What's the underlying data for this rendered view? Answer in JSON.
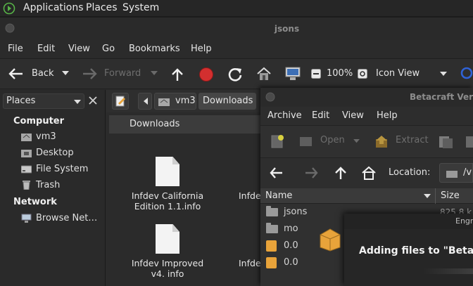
{
  "panel": {
    "applications": "Applications",
    "places": "Places",
    "system": "System"
  },
  "file_manager": {
    "title": "jsons",
    "menu": [
      "File",
      "Edit",
      "View",
      "Go",
      "Bookmarks",
      "Help"
    ],
    "toolbar": {
      "back": "Back",
      "forward": "Forward",
      "zoom": "100%",
      "view_mode": "Icon View"
    },
    "sidebar": {
      "selector": "Places",
      "computer_heading": "Computer",
      "computer_items": [
        "vm3",
        "Desktop",
        "File System",
        "Trash"
      ],
      "network_heading": "Network",
      "network_items": [
        "Browse Net…"
      ]
    },
    "pathbar": {
      "crumbs": [
        "vm3",
        "Downloads"
      ]
    },
    "location_header": "Downloads",
    "files": [
      {
        "name": "Infdev California Edition 1.1.info"
      },
      {
        "name": "Infde"
      },
      {
        "name": "Infdev Improved v4. info"
      },
      {
        "name": "Infde"
      }
    ]
  },
  "archive_manager": {
    "title": "Betacraft Versi",
    "menu": [
      "Archive",
      "Edit",
      "View",
      "Help"
    ],
    "toolbar": {
      "open": "Open",
      "extract": "Extract"
    },
    "location_label": "Location:",
    "location_value": "/v",
    "columns": {
      "name": "Name",
      "size": "Size"
    },
    "rows": [
      {
        "name": "jsons",
        "size": "825.8 k",
        "type": "folder"
      },
      {
        "name": "mo",
        "size": "",
        "type": "folder"
      },
      {
        "name": "0.0",
        "size": "",
        "type": "package"
      },
      {
        "name": "0.0",
        "size": "",
        "type": "package"
      }
    ]
  },
  "progress_dialog": {
    "title": "Engr",
    "message": "Adding files to \"Betacr"
  },
  "colors": {
    "panel_bg": "#262626",
    "window_bg": "#2b2b2b",
    "stop_red": "#d32f2f",
    "package_orange": "#e8a33a",
    "search_blue": "#2f62d6"
  }
}
